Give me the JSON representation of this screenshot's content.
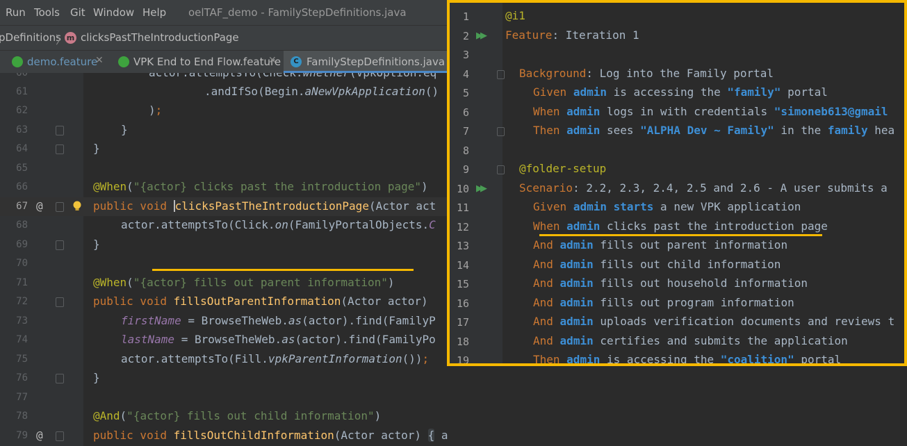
{
  "menu": {
    "items": [
      "Run",
      "Tools",
      "Git",
      "Window",
      "Help"
    ],
    "title": "oelTAF_demo - FamilyStepDefinitions.java"
  },
  "breadcrumb": {
    "class_name": "pDefinitions",
    "method_name": "clicksPastTheIntroductionPage"
  },
  "tabs": [
    {
      "label": "demo.feature",
      "icon": "cucumber-icon",
      "active": false
    },
    {
      "label": "VPK End to End Flow.feature",
      "icon": "cucumber-icon",
      "active": false
    },
    {
      "label": "FamilyStepDefinitions.java",
      "icon": "class-icon",
      "active": true
    }
  ],
  "colors": {
    "highlight": "#f5b800",
    "keyword": "#cc7832",
    "annotation": "#bbb529",
    "string": "#6a8759",
    "step_param": "#3d8fd6"
  },
  "java_lines": [
    {
      "n": "60",
      "text": "actor.attemptsTo(Check.whether(VpkOption.eq"
    },
    {
      "n": "61",
      "text": ".andIfSo(Begin.aNewVpkApplication()"
    },
    {
      "n": "62",
      "text": ");"
    },
    {
      "n": "63",
      "text": "}"
    },
    {
      "n": "64",
      "text": "}"
    },
    {
      "n": "65",
      "text": ""
    },
    {
      "n": "66",
      "text": "@When(\"{actor} clicks past the introduction page\")"
    },
    {
      "n": "67",
      "text": "public void clicksPastTheIntroductionPage(Actor act"
    },
    {
      "n": "68",
      "text": "actor.attemptsTo(Click.on(FamilyPortalObjects.C"
    },
    {
      "n": "69",
      "text": "}"
    },
    {
      "n": "70",
      "text": ""
    },
    {
      "n": "71",
      "text": "@When(\"{actor} fills out parent information\")"
    },
    {
      "n": "72",
      "text": "public void fillsOutParentInformation(Actor actor)"
    },
    {
      "n": "73",
      "text": "firstName = BrowseTheWeb.as(actor).find(FamilyP"
    },
    {
      "n": "74",
      "text": "lastName = BrowseTheWeb.as(actor).find(FamilyPo"
    },
    {
      "n": "75",
      "text": "actor.attemptsTo(Fill.vpkParentInformation());"
    },
    {
      "n": "76",
      "text": "}"
    },
    {
      "n": "77",
      "text": ""
    },
    {
      "n": "78",
      "text": "@And(\"{actor} fills out child information\")"
    },
    {
      "n": "79",
      "text": "public void fillsOutChildInformation(Actor actor) { actor.attemptsTo(Fill.vpkChildInformation()); }"
    }
  ],
  "feature_lines": [
    {
      "n": "1",
      "text": "@i1"
    },
    {
      "n": "2",
      "text": "Feature: Iteration 1"
    },
    {
      "n": "3",
      "text": ""
    },
    {
      "n": "4",
      "text": "Background: Log into the Family portal"
    },
    {
      "n": "5",
      "text": "Given admin is accessing the \"family\" portal"
    },
    {
      "n": "6",
      "text": "When admin logs in with credentials \"simoneb613@gmail"
    },
    {
      "n": "7",
      "text": "Then admin sees \"ALPHA Dev ~ Family\" in the family hea"
    },
    {
      "n": "8",
      "text": ""
    },
    {
      "n": "9",
      "text": "@folder-setup"
    },
    {
      "n": "10",
      "text": "Scenario: 2.2, 2.3, 2.4, 2.5 and 2.6 - A user submits a"
    },
    {
      "n": "11",
      "text": "Given admin starts a new VPK application"
    },
    {
      "n": "12",
      "text": "When admin clicks past the introduction page"
    },
    {
      "n": "13",
      "text": "And admin fills out parent information"
    },
    {
      "n": "14",
      "text": "And admin fills out child information"
    },
    {
      "n": "15",
      "text": "And admin fills out household information"
    },
    {
      "n": "16",
      "text": "And admin fills out program information"
    },
    {
      "n": "17",
      "text": "And admin uploads verification documents and reviews t"
    },
    {
      "n": "18",
      "text": "And admin certifies and submits the application"
    },
    {
      "n": "19",
      "text": "Then admin is accessing the \"coalition\" portal"
    }
  ]
}
